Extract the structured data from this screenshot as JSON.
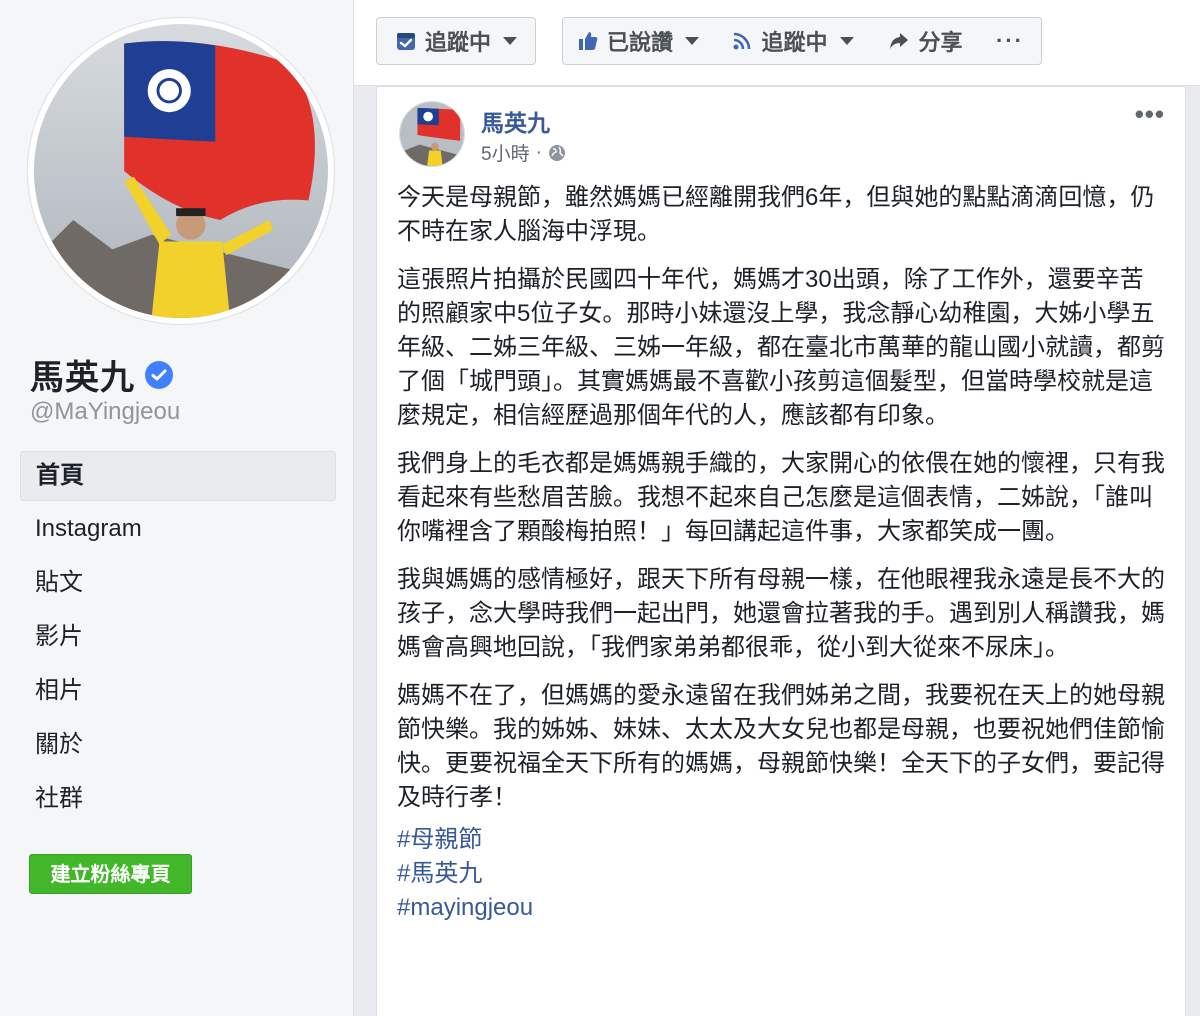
{
  "profile": {
    "name": "馬英九",
    "username": "@MaYingjeou"
  },
  "nav": {
    "items": [
      {
        "label": "首頁",
        "active": true
      },
      {
        "label": "Instagram",
        "active": false
      },
      {
        "label": "貼文",
        "active": false
      },
      {
        "label": "影片",
        "active": false
      },
      {
        "label": "相片",
        "active": false
      },
      {
        "label": "關於",
        "active": false
      },
      {
        "label": "社群",
        "active": false
      }
    ],
    "create_page_label": "建立粉絲專頁"
  },
  "actionbar": {
    "following_label": "追蹤中",
    "liked_label": "已說讚",
    "following2_label": "追蹤中",
    "share_label": "分享",
    "more_label": "···"
  },
  "post": {
    "author": "馬英九",
    "time": "5小時",
    "separator": "·",
    "more_label": "•••",
    "paragraphs": [
      "今天是母親節，雖然媽媽已經離開我們6年，但與她的點點滴滴回憶，仍不時在家人腦海中浮現。",
      "這張照片拍攝於民國四十年代，媽媽才30出頭，除了工作外，還要辛苦的照顧家中5位子女。那時小妹還沒上學，我念靜心幼稚園，大姊小學五年級、二姊三年級、三姊一年級，都在臺北市萬華的龍山國小就讀，都剪了個「城門頭」。其實媽媽最不喜歡小孩剪這個髮型，但當時學校就是這麼規定，相信經歷過那個年代的人，應該都有印象。",
      "我們身上的毛衣都是媽媽親手織的，大家開心的依偎在她的懷裡，只有我看起來有些愁眉苦臉。我想不起來自己怎麼是這個表情，二姊說，「誰叫你嘴裡含了顆酸梅拍照！」每回講起這件事，大家都笑成一團。",
      "我與媽媽的感情極好，跟天下所有母親一樣，在他眼裡我永遠是長不大的孩子，念大學時我們一起出門，她還會拉著我的手。遇到別人稱讚我，媽媽會高興地回說，「我們家弟弟都很乖，從小到大從來不尿床」。",
      "媽媽不在了，但媽媽的愛永遠留在我們姊弟之間，我要祝在天上的她母親節快樂。我的姊姊、妹妹、太太及大女兒也都是母親，也要祝她們佳節愉快。更要祝福全天下所有的媽媽，母親節快樂！全天下的子女們，要記得及時行孝！"
    ],
    "hashtags": [
      "#母親節",
      "#馬英九",
      "#mayingjeou"
    ]
  },
  "colors": {
    "link": "#385898",
    "create_button": "#42b72a",
    "verified": "#4080ff",
    "flag_red": "#e0312b",
    "flag_blue": "#1f3f94"
  },
  "icons": {
    "verified": "check-badge-icon",
    "following": "following-icon",
    "liked": "thumbs-up-icon",
    "rss": "rss-icon",
    "share": "share-arrow-icon",
    "globe": "globe-icon"
  }
}
